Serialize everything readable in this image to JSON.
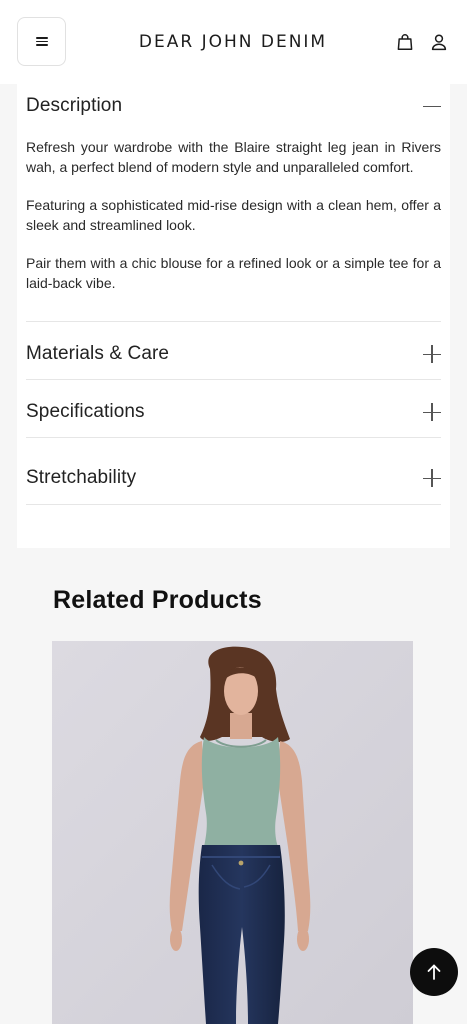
{
  "header": {
    "brand": "DEAR JOHN DENIM",
    "menu_icon": "hamburger-menu-icon",
    "cart_icon": "shopping-bag-icon",
    "account_icon": "user-icon"
  },
  "accordion": {
    "description": {
      "title": "Description",
      "state": "expanded",
      "paragraphs": [
        "Refresh your wardrobe with the Blaire straight leg jean in Rivers wah, a perfect blend of modern style and unparalleled comfort.",
        "Featuring a sophisticated mid-rise design with a clean hem, offer a sleek and streamlined look.",
        "Pair them with a chic blouse for a refined look or a simple tee for a laid-back vibe."
      ]
    },
    "materials": {
      "title": "Materials & Care",
      "state": "collapsed"
    },
    "specifications": {
      "title": "Specifications",
      "state": "collapsed"
    },
    "stretchability": {
      "title": "Stretchability",
      "state": "collapsed"
    }
  },
  "related": {
    "title": "Related Products",
    "product_image_alt": "Model wearing sage green tank top and dark blue skinny jeans"
  },
  "scroll_top_icon": "arrow-up-icon",
  "colors": {
    "header_bg": "#ffffff",
    "page_bg": "#f6f6f6",
    "scroll_button": "#0d0d0d",
    "tank_top": "#8fb0a2",
    "denim": "#1d2c4f"
  }
}
